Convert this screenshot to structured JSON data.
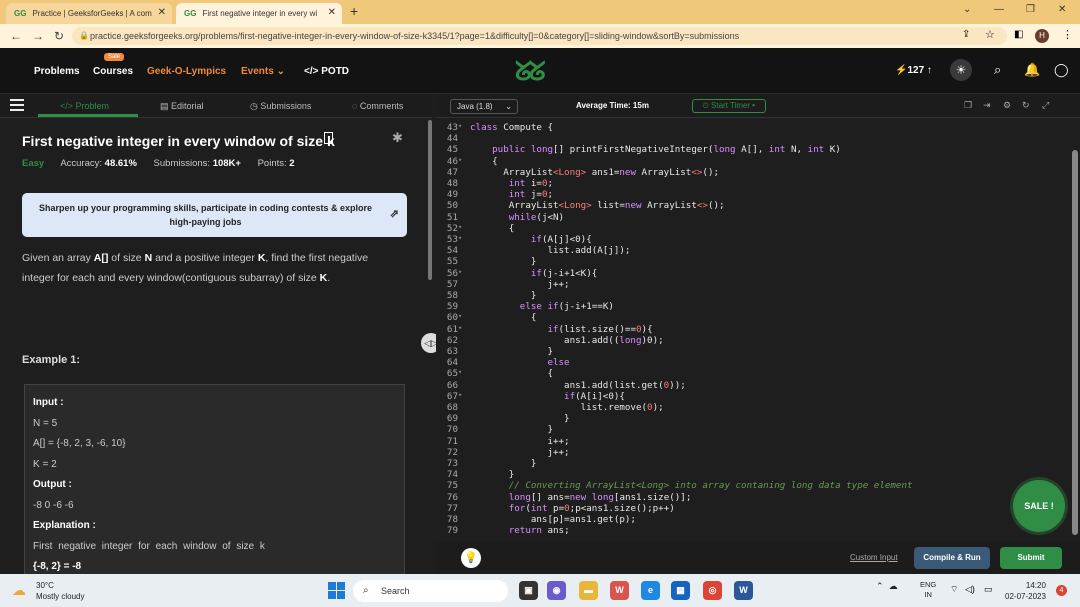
{
  "browser": {
    "tabs": [
      {
        "label": "Practice | GeeksforGeeks | A com",
        "favicon": "GG"
      },
      {
        "label": "First negative integer in every wi",
        "favicon": "GG"
      }
    ],
    "url": "practice.geeksforgeeks.org/problems/first-negative-integer-in-every-window-of-size-k3345/1?page=1&difficulty[]=0&category[]=sliding-window&sortBy=submissions",
    "profile_initial": "H"
  },
  "nav": {
    "problems": "Problems",
    "courses": "Courses",
    "sale_badge": "Sale",
    "geek_o_lympics": "Geek-O-Lympics",
    "events": "Events",
    "potd": "POTD",
    "logo": "ᘜᘜ",
    "streak": "127"
  },
  "left_tabs": {
    "problem": "Problem",
    "editorial": "Editorial",
    "submissions": "Submissions",
    "comments": "Comments"
  },
  "problem": {
    "title": "First negative integer in every window of size k",
    "difficulty": "Easy",
    "accuracy_label": "Accuracy:",
    "accuracy": "48.61%",
    "submissions_label": "Submissions:",
    "submissions": "108K+",
    "points_label": "Points:",
    "points": "2",
    "banner": "Sharpen up your programming skills, participate in coding contests & explore high-paying jobs",
    "desc_1": "Given an array ",
    "desc_arr": "A[]",
    "desc_2": " of size ",
    "desc_n": "N",
    "desc_3": " and a positive integer ",
    "desc_k": "K",
    "desc_4": ", find the first negative integer for each and every window(contiguous subarray) of size ",
    "desc_k2": "K",
    "desc_5": ".",
    "example_title": "Example 1:",
    "example": {
      "input_label": "Input :",
      "n": "N = 5",
      "a": "A[] = {-8, 2, 3, -6, 10}",
      "k": "K = 2",
      "output_label": "Output :",
      "output": "-8 0 -6 -6",
      "explanation_label": "Explanation :",
      "explanation": "First negative integer for each window of size k",
      "last": "{-8, 2} = -8"
    }
  },
  "editor": {
    "language": "Java (1.8)",
    "avg_time": "Average Time: 15m",
    "timer": "Start Timer",
    "custom_input": "Custom Input",
    "compile": "Compile & Run",
    "submit": "Submit",
    "sale": "SALE !",
    "lines": [
      {
        "n": "43",
        "f": "▾",
        "t": "class Compute {"
      },
      {
        "n": "44",
        "f": "",
        "t": ""
      },
      {
        "n": "45",
        "f": "",
        "t": "    public long[] printFirstNegativeInteger(long A[], int N, int K)"
      },
      {
        "n": "46",
        "f": "▾",
        "t": "    {"
      },
      {
        "n": "47",
        "f": "",
        "t": "      ArrayList<Long> ans1=new ArrayList<>();"
      },
      {
        "n": "48",
        "f": "",
        "t": "       int i=0;"
      },
      {
        "n": "49",
        "f": "",
        "t": "       int j=0;"
      },
      {
        "n": "50",
        "f": "",
        "t": "       ArrayList<Long> list=new ArrayList<>();"
      },
      {
        "n": "51",
        "f": "",
        "t": "       while(j<N)"
      },
      {
        "n": "52",
        "f": "▾",
        "t": "       {"
      },
      {
        "n": "53",
        "f": "▾",
        "t": "           if(A[j]<0){"
      },
      {
        "n": "54",
        "f": "",
        "t": "              list.add(A[j]);"
      },
      {
        "n": "55",
        "f": "",
        "t": "           }"
      },
      {
        "n": "56",
        "f": "▾",
        "t": "           if(j-i+1<K){"
      },
      {
        "n": "57",
        "f": "",
        "t": "              j++;"
      },
      {
        "n": "58",
        "f": "",
        "t": "           }"
      },
      {
        "n": "59",
        "f": "",
        "t": "         else if(j-i+1==K)"
      },
      {
        "n": "60",
        "f": "▾",
        "t": "           {"
      },
      {
        "n": "61",
        "f": "▾",
        "t": "              if(list.size()==0){"
      },
      {
        "n": "62",
        "f": "",
        "t": "                 ans1.add((long)0);"
      },
      {
        "n": "63",
        "f": "",
        "t": "              }"
      },
      {
        "n": "64",
        "f": "",
        "t": "              else"
      },
      {
        "n": "65",
        "f": "▾",
        "t": "              {"
      },
      {
        "n": "66",
        "f": "",
        "t": "                 ans1.add(list.get(0));"
      },
      {
        "n": "67",
        "f": "▾",
        "t": "                 if(A[i]<0){"
      },
      {
        "n": "68",
        "f": "",
        "t": "                    list.remove(0);"
      },
      {
        "n": "69",
        "f": "",
        "t": "                 }"
      },
      {
        "n": "70",
        "f": "",
        "t": "              }"
      },
      {
        "n": "71",
        "f": "",
        "t": "              i++;"
      },
      {
        "n": "72",
        "f": "",
        "t": "              j++;"
      },
      {
        "n": "73",
        "f": "",
        "t": "           }"
      },
      {
        "n": "74",
        "f": "",
        "t": "       }"
      },
      {
        "n": "75",
        "f": "",
        "t": "       // Converting ArrayList<Long> into array contaning long data type element",
        "c": true
      },
      {
        "n": "76",
        "f": "",
        "t": "       long[] ans=new long[ans1.size()];"
      },
      {
        "n": "77",
        "f": "",
        "t": "       for(int p=0;p<ans1.size();p++)"
      },
      {
        "n": "78",
        "f": "",
        "t": "           ans[p]=ans1.get(p);"
      },
      {
        "n": "79",
        "f": "",
        "t": "       return ans;"
      }
    ]
  },
  "taskbar": {
    "temp": "30°C",
    "weather": "Mostly cloudy",
    "search": "Search",
    "lang_1": "ENG",
    "lang_2": "IN",
    "time": "14:20",
    "date": "02-07-2023",
    "notifications": "4"
  }
}
